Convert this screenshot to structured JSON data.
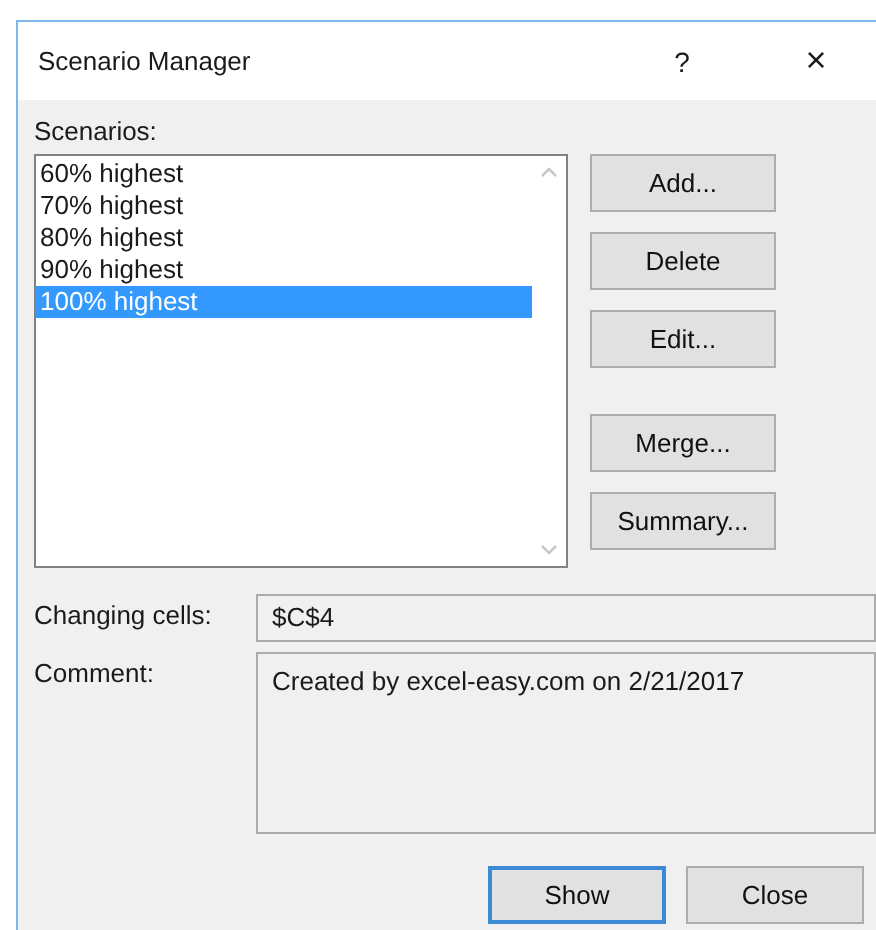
{
  "window": {
    "title": "Scenario Manager",
    "help": "?",
    "close": "×"
  },
  "scenarios": {
    "label": "Scenarios:",
    "items": [
      {
        "label": "60% highest",
        "selected": false
      },
      {
        "label": "70% highest",
        "selected": false
      },
      {
        "label": "80% highest",
        "selected": false
      },
      {
        "label": "90% highest",
        "selected": false
      },
      {
        "label": "100% highest",
        "selected": true
      }
    ]
  },
  "side_button_groups": [
    [
      {
        "label": "Add..."
      },
      {
        "label": "Delete"
      },
      {
        "label": "Edit..."
      }
    ],
    [
      {
        "label": "Merge..."
      },
      {
        "label": "Summary..."
      }
    ]
  ],
  "changing_cells": {
    "label": "Changing cells:",
    "value": "$C$4"
  },
  "comment": {
    "label": "Comment:",
    "value": "Created by excel-easy.com on 2/21/2017"
  },
  "footer_buttons": [
    {
      "label": "Show",
      "default": true
    },
    {
      "label": "Close",
      "default": false
    }
  ]
}
